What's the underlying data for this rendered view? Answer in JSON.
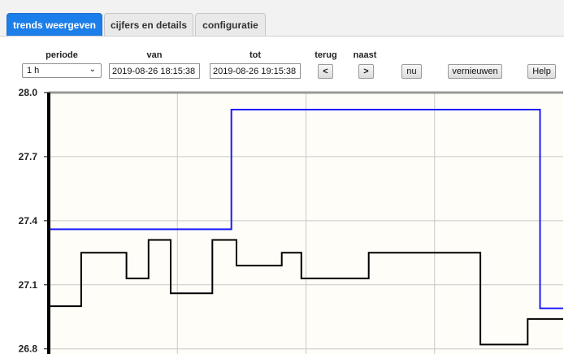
{
  "tabs": [
    {
      "label": "trends weergeven",
      "active": true
    },
    {
      "label": "cijfers en details",
      "active": false
    },
    {
      "label": "configuratie",
      "active": false
    }
  ],
  "controls": {
    "period_label": "periode",
    "period_value": "1 h",
    "from_label": "van",
    "from_value": "2019-08-26 18:15:38",
    "to_label": "tot",
    "to_value": "2019-08-26 19:15:38",
    "back_label": "terug",
    "back_button": "<",
    "next_label": "naast",
    "next_button": ">",
    "now_button": "nu",
    "refresh_button": "vernieuwen",
    "help_button": "Help"
  },
  "colors": {
    "accent": "#1c7ee8",
    "plot_background": "#fffdf7",
    "series_blue": "#1a1aff",
    "series_black": "#000000"
  },
  "chart_data": {
    "type": "line",
    "step": true,
    "ylim": [
      26.7,
      28.0
    ],
    "yticks": [
      "28.0",
      "27.7",
      "27.4",
      "27.1",
      "26.8"
    ],
    "xlim": [
      0,
      1
    ],
    "grid": true,
    "series": [
      {
        "color": "#1a1aff",
        "x": [
          0,
          0.355,
          0.355,
          0.955,
          0.955,
          1.0
        ],
        "y": [
          27.36,
          27.36,
          27.92,
          27.92,
          26.99,
          26.99
        ]
      },
      {
        "color": "#000000",
        "x": [
          0,
          0.063,
          0.063,
          0.151,
          0.151,
          0.194,
          0.194,
          0.237,
          0.237,
          0.318,
          0.318,
          0.365,
          0.365,
          0.453,
          0.453,
          0.491,
          0.491,
          0.622,
          0.622,
          0.839,
          0.839,
          0.931,
          0.931,
          1.0
        ],
        "y": [
          27.0,
          27.0,
          27.25,
          27.25,
          27.13,
          27.13,
          27.31,
          27.31,
          27.06,
          27.06,
          27.31,
          27.31,
          27.19,
          27.19,
          27.25,
          27.25,
          27.13,
          27.13,
          27.25,
          27.25,
          26.82,
          26.82,
          26.94,
          26.94
        ]
      }
    ]
  }
}
